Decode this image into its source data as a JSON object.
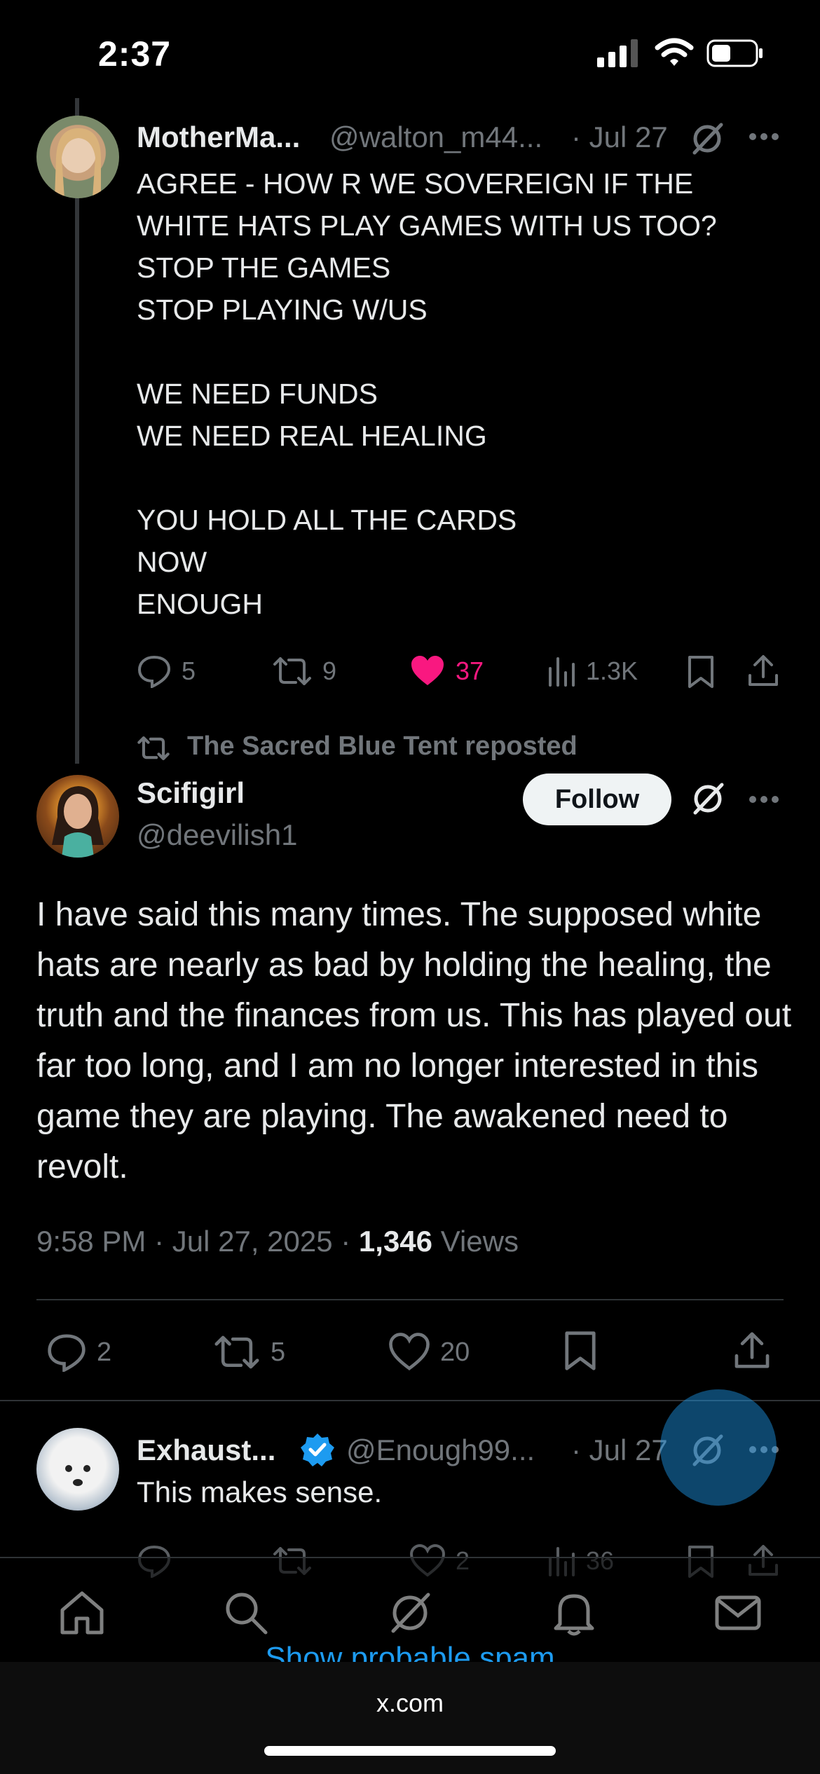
{
  "status_bar": {
    "time": "2:37"
  },
  "reply_tweet": {
    "display_name": "MotherMa...",
    "handle": "@walton_m44...",
    "date": "· Jul 27",
    "text": "AGREE - HOW R WE SOVEREIGN IF THE\nWHITE HATS PLAY GAMES WITH US TOO?\nSTOP THE GAMES\nSTOP PLAYING W/US\n\nWE NEED FUNDS\nWE NEED REAL HEALING\n\nYOU HOLD ALL THE CARDS\nNOW\nENOUGH",
    "replies": "5",
    "reposts": "9",
    "likes": "37",
    "views": "1.3K",
    "like_color": "#f91880"
  },
  "repost_context": "The Sacred Blue Tent reposted",
  "main_tweet": {
    "display_name": "Scifigirl",
    "handle": "@deevilish1",
    "follow_label": "Follow",
    "text": "I have said this many times. The supposed white hats are nearly as bad by holding the healing, the truth and the finances from us. This has played out far too long, and I am no longer interested in this game they are playing. The awakened need to revolt.",
    "time": "9:58 PM · Jul 27, 2025 · ",
    "views_count": "1,346",
    "views_label": "Views",
    "replies": "2",
    "reposts": "5",
    "likes": "20"
  },
  "next_reply": {
    "display_name": "Exhaust...",
    "handle": "@Enough99...",
    "date": "· Jul 27",
    "text": "This makes sense.",
    "likes": "2",
    "views": "36",
    "verified_color": "#1d9bf0"
  },
  "spam_link": "Show probable spam",
  "browser": {
    "url": "x.com"
  },
  "icons": [
    "reply-icon",
    "repost-icon",
    "like-icon",
    "views-icon",
    "bookmark-icon",
    "share-icon",
    "grok-icon",
    "more-icon",
    "home-icon",
    "search-icon",
    "bell-icon",
    "mail-icon"
  ]
}
